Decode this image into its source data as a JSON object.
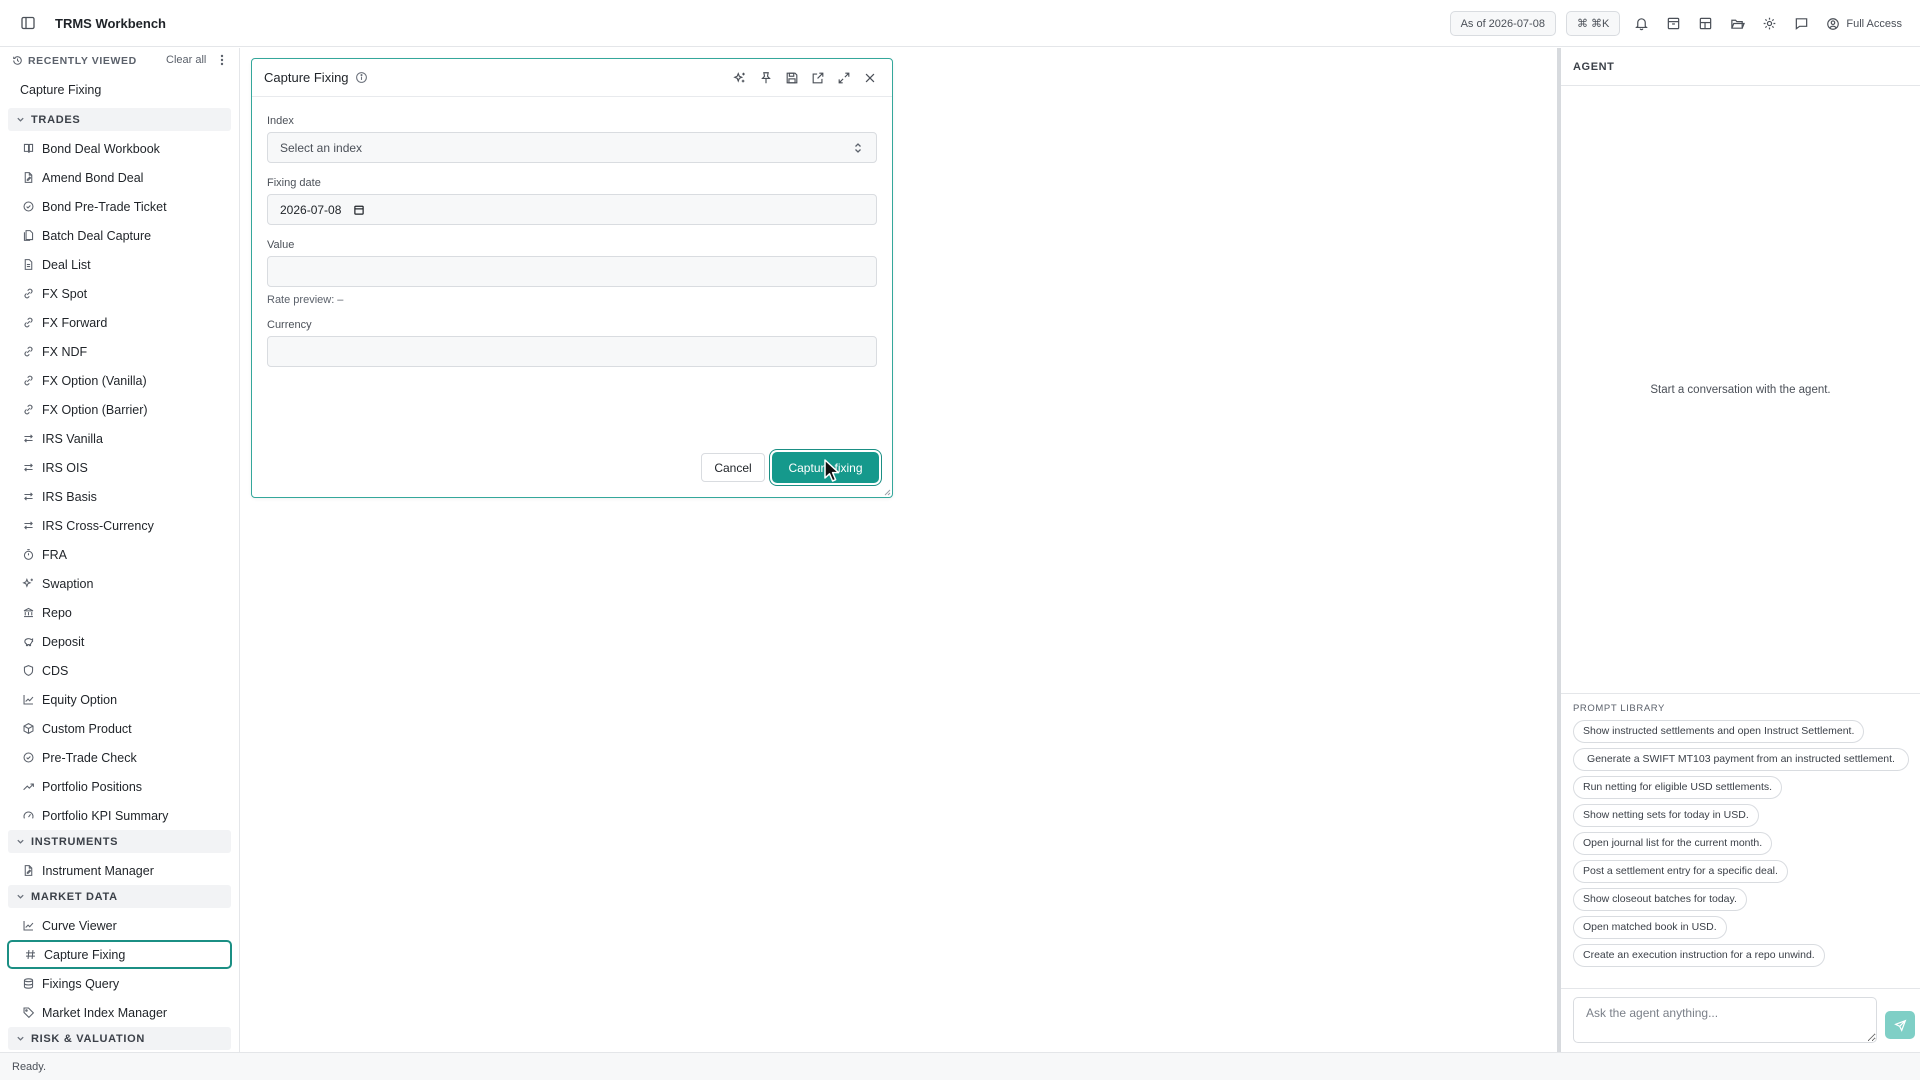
{
  "app": {
    "title": "TRMS Workbench"
  },
  "topbar": {
    "as_of": "As of 2026-07-08",
    "shortcut": "⌘ ⌘K",
    "access": "Full Access"
  },
  "sidebar": {
    "recent": {
      "title": "RECENTLY VIEWED",
      "clear": "Clear all",
      "items": [
        "Capture Fixing"
      ]
    },
    "sections": [
      {
        "title": "TRADES",
        "items": [
          {
            "label": "Bond Deal Workbook",
            "icon": "book-icon"
          },
          {
            "label": "Amend Bond Deal",
            "icon": "file-edit-icon"
          },
          {
            "label": "Bond Pre-Trade Ticket",
            "icon": "check-circle-icon"
          },
          {
            "label": "Batch Deal Capture",
            "icon": "file-stack-icon"
          },
          {
            "label": "Deal List",
            "icon": "file-list-icon"
          },
          {
            "label": "FX Spot",
            "icon": "link-icon"
          },
          {
            "label": "FX Forward",
            "icon": "link-icon"
          },
          {
            "label": "FX NDF",
            "icon": "link-icon"
          },
          {
            "label": "FX Option (Vanilla)",
            "icon": "link-icon"
          },
          {
            "label": "FX Option (Barrier)",
            "icon": "link-icon"
          },
          {
            "label": "IRS Vanilla",
            "icon": "swap-icon"
          },
          {
            "label": "IRS OIS",
            "icon": "swap-icon"
          },
          {
            "label": "IRS Basis",
            "icon": "swap-icon"
          },
          {
            "label": "IRS Cross-Currency",
            "icon": "swap-icon"
          },
          {
            "label": "FRA",
            "icon": "timer-icon"
          },
          {
            "label": "Swaption",
            "icon": "sparkle-icon"
          },
          {
            "label": "Repo",
            "icon": "bank-icon"
          },
          {
            "label": "Deposit",
            "icon": "piggy-bank-icon"
          },
          {
            "label": "CDS",
            "icon": "shield-icon"
          },
          {
            "label": "Equity Option",
            "icon": "chart-line-icon"
          },
          {
            "label": "Custom Product",
            "icon": "cube-icon"
          },
          {
            "label": "Pre-Trade Check",
            "icon": "check-circle-icon"
          },
          {
            "label": "Portfolio Positions",
            "icon": "trending-up-icon"
          },
          {
            "label": "Portfolio KPI Summary",
            "icon": "gauge-icon"
          }
        ]
      },
      {
        "title": "INSTRUMENTS",
        "items": [
          {
            "label": "Instrument Manager",
            "icon": "file-edit-icon"
          }
        ]
      },
      {
        "title": "MARKET DATA",
        "items": [
          {
            "label": "Curve Viewer",
            "icon": "chart-line-icon"
          },
          {
            "label": "Capture Fixing",
            "icon": "hash-icon",
            "active": true
          },
          {
            "label": "Fixings Query",
            "icon": "database-icon"
          },
          {
            "label": "Market Index Manager",
            "icon": "tag-icon"
          }
        ]
      },
      {
        "title": "RISK & VALUATION",
        "items": []
      }
    ]
  },
  "dialog": {
    "title": "Capture Fixing",
    "index_label": "Index",
    "index_placeholder": "Select an index",
    "fixing_date_label": "Fixing date",
    "fixing_date_value": "2026-07-08",
    "value_label": "Value",
    "value_value": "",
    "rate_preview": "Rate preview: –",
    "currency_label": "Currency",
    "currency_value": "",
    "cancel_label": "Cancel",
    "submit_label": "Capture fixing"
  },
  "agent": {
    "title": "AGENT",
    "empty": "Start a conversation with the agent.",
    "prompt_library_title": "PROMPT LIBRARY",
    "prompts": [
      "Show instructed settlements and open Instruct Settlement.",
      "Generate a SWIFT MT103 payment from an instructed settlement.",
      "Run netting for eligible USD settlements.",
      "Show netting sets for today in USD.",
      "Open journal list for the current month.",
      "Post a settlement entry for a specific deal.",
      "Show closeout batches for today.",
      "Open matched book in USD.",
      "Create an execution instruction for a repo unwind."
    ],
    "input_placeholder": "Ask the agent anything..."
  },
  "status": {
    "text": "Ready."
  },
  "colors": {
    "accent": "#15998c",
    "accent_border": "#1b8f84",
    "send": "#7fcfc6"
  }
}
